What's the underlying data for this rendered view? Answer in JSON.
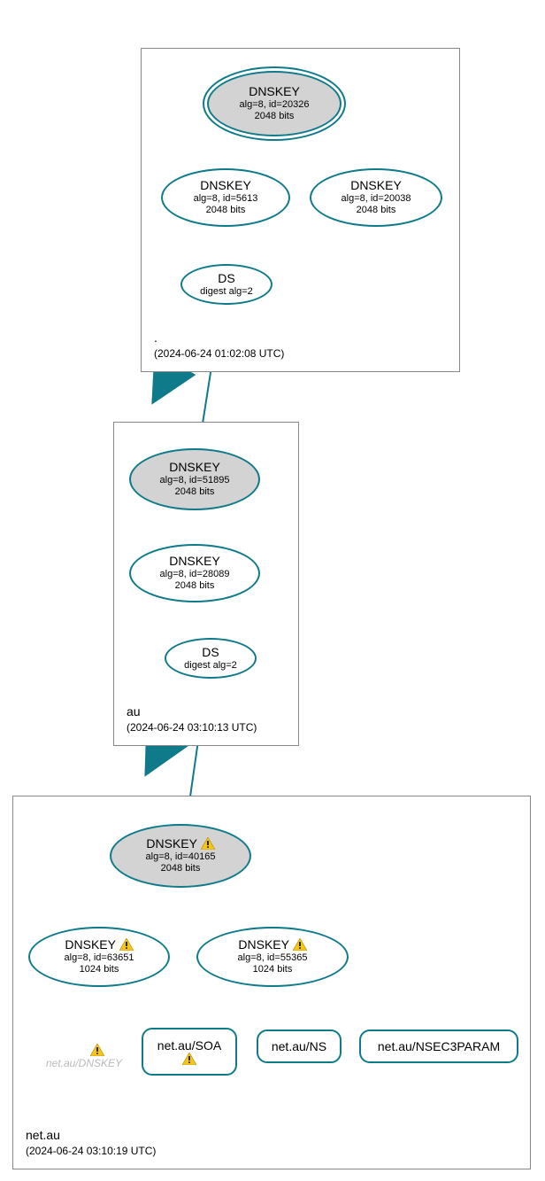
{
  "zones": {
    "root": {
      "name": ".",
      "timestamp": "(2024-06-24 01:02:08 UTC)"
    },
    "au": {
      "name": "au",
      "timestamp": "(2024-06-24 03:10:13 UTC)"
    },
    "netau": {
      "name": "net.au",
      "timestamp": "(2024-06-24 03:10:19 UTC)"
    }
  },
  "nodes": {
    "root_ksk": {
      "title": "DNSKEY",
      "l2": "alg=8, id=20326",
      "l3": "2048 bits"
    },
    "root_zsk1": {
      "title": "DNSKEY",
      "l2": "alg=8, id=5613",
      "l3": "2048 bits"
    },
    "root_zsk2": {
      "title": "DNSKEY",
      "l2": "alg=8, id=20038",
      "l3": "2048 bits"
    },
    "root_ds": {
      "title": "DS",
      "l2": "digest alg=2"
    },
    "au_ksk": {
      "title": "DNSKEY",
      "l2": "alg=8, id=51895",
      "l3": "2048 bits"
    },
    "au_zsk": {
      "title": "DNSKEY",
      "l2": "alg=8, id=28089",
      "l3": "2048 bits"
    },
    "au_ds": {
      "title": "DS",
      "l2": "digest alg=2"
    },
    "netau_ksk": {
      "title": "DNSKEY",
      "warn": true,
      "l2": "alg=8, id=40165",
      "l3": "2048 bits"
    },
    "netau_zsk1": {
      "title": "DNSKEY",
      "warn": true,
      "l2": "alg=8, id=63651",
      "l3": "1024 bits"
    },
    "netau_zsk2": {
      "title": "DNSKEY",
      "warn": true,
      "l2": "alg=8, id=55365",
      "l3": "1024 bits"
    },
    "rr_soa": {
      "label": "net.au/SOA",
      "warn": true
    },
    "rr_ns": {
      "label": "net.au/NS"
    },
    "rr_nsec3": {
      "label": "net.au/NSEC3PARAM"
    },
    "ghost": {
      "label": "net.au/DNSKEY"
    }
  },
  "chart_data": {
    "type": "graph",
    "description": "DNSSEC authentication chain (DNSViz style) for net.au",
    "zones": [
      {
        "name": ".",
        "timestamp": "2024-06-24 01:02:08 UTC"
      },
      {
        "name": "au",
        "timestamp": "2024-06-24 03:10:13 UTC"
      },
      {
        "name": "net.au",
        "timestamp": "2024-06-24 03:10:19 UTC"
      }
    ],
    "nodes": [
      {
        "id": "root_ksk",
        "zone": ".",
        "type": "DNSKEY",
        "alg": 8,
        "key_id": 20326,
        "bits": 2048,
        "ksk": true,
        "warn": false
      },
      {
        "id": "root_zsk1",
        "zone": ".",
        "type": "DNSKEY",
        "alg": 8,
        "key_id": 5613,
        "bits": 2048,
        "ksk": false,
        "warn": false
      },
      {
        "id": "root_zsk2",
        "zone": ".",
        "type": "DNSKEY",
        "alg": 8,
        "key_id": 20038,
        "bits": 2048,
        "ksk": false,
        "warn": false
      },
      {
        "id": "root_ds",
        "zone": ".",
        "type": "DS",
        "digest_alg": 2
      },
      {
        "id": "au_ksk",
        "zone": "au",
        "type": "DNSKEY",
        "alg": 8,
        "key_id": 51895,
        "bits": 2048,
        "ksk": true,
        "warn": false
      },
      {
        "id": "au_zsk",
        "zone": "au",
        "type": "DNSKEY",
        "alg": 8,
        "key_id": 28089,
        "bits": 2048,
        "ksk": false,
        "warn": false
      },
      {
        "id": "au_ds",
        "zone": "au",
        "type": "DS",
        "digest_alg": 2
      },
      {
        "id": "netau_ksk",
        "zone": "net.au",
        "type": "DNSKEY",
        "alg": 8,
        "key_id": 40165,
        "bits": 2048,
        "ksk": true,
        "warn": true
      },
      {
        "id": "netau_zsk1",
        "zone": "net.au",
        "type": "DNSKEY",
        "alg": 8,
        "key_id": 63651,
        "bits": 1024,
        "ksk": false,
        "warn": true
      },
      {
        "id": "netau_zsk2",
        "zone": "net.au",
        "type": "DNSKEY",
        "alg": 8,
        "key_id": 55365,
        "bits": 1024,
        "ksk": false,
        "warn": true
      },
      {
        "id": "rr_soa",
        "zone": "net.au",
        "type": "RRset",
        "label": "net.au/SOA",
        "warn": true
      },
      {
        "id": "rr_ns",
        "zone": "net.au",
        "type": "RRset",
        "label": "net.au/NS"
      },
      {
        "id": "rr_nsec3",
        "zone": "net.au",
        "type": "RRset",
        "label": "net.au/NSEC3PARAM"
      },
      {
        "id": "ghost",
        "zone": "net.au",
        "type": "alias",
        "label": "net.au/DNSKEY",
        "warn": true
      }
    ],
    "edges": [
      {
        "from": "root_ksk",
        "to": "root_ksk",
        "kind": "self"
      },
      {
        "from": "root_ksk",
        "to": "root_zsk1"
      },
      {
        "from": "root_ksk",
        "to": "root_zsk2"
      },
      {
        "from": "root_zsk1",
        "to": "root_ds"
      },
      {
        "from": "root_ds",
        "to": "au_ksk",
        "kind": "delegation"
      },
      {
        "from": "au_ksk",
        "to": "au_ksk",
        "kind": "self"
      },
      {
        "from": "au_ksk",
        "to": "au_zsk"
      },
      {
        "from": "au_zsk",
        "to": "au_ds"
      },
      {
        "from": "au_ds",
        "to": "netau_ksk",
        "kind": "delegation"
      },
      {
        "from": "netau_ksk",
        "to": "netau_ksk",
        "kind": "self"
      },
      {
        "from": "netau_ksk",
        "to": "netau_zsk1"
      },
      {
        "from": "netau_ksk",
        "to": "netau_zsk2"
      },
      {
        "from": "netau_zsk2",
        "to": "rr_soa"
      },
      {
        "from": "netau_zsk2",
        "to": "rr_ns"
      },
      {
        "from": "netau_zsk2",
        "to": "rr_nsec3"
      }
    ]
  }
}
